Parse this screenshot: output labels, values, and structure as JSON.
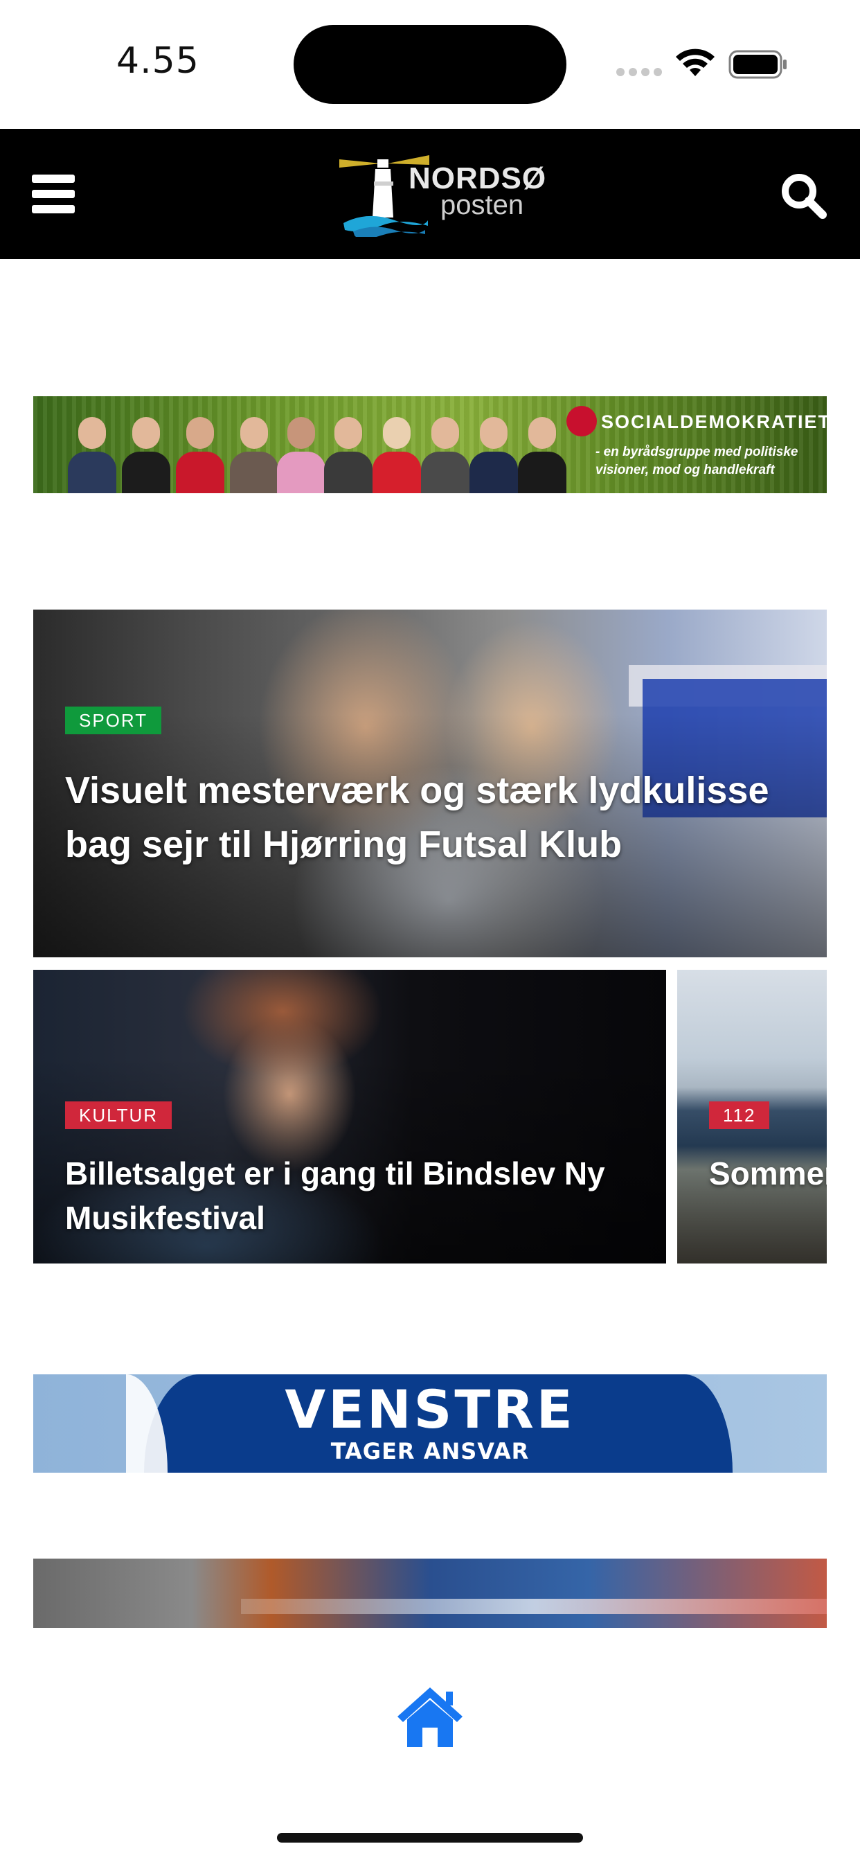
{
  "status_bar": {
    "time": "4.55"
  },
  "header": {
    "logo_word": "NORDSØ",
    "logo_sub": "posten"
  },
  "ads": {
    "socialdemokratiet": {
      "title": "SOCIALDEMOKRATIET",
      "tagline": "- en byrådsgruppe med politiske visioner, mod og handlekraft"
    },
    "venstre": {
      "title": "VENSTRE",
      "subtitle": "TAGER ANSVAR"
    }
  },
  "articles": [
    {
      "category": "SPORT",
      "category_color": "#0f9a3c",
      "headline": "Visuelt mesterværk og stærk lydkulisse bag sejr til Hjørring Futsal Klub"
    },
    {
      "category": "KULTUR",
      "category_color": "#d0273b",
      "headline": "Billetsalget er i gang til Bindslev Ny Musikfestival"
    },
    {
      "category": "112",
      "category_color": "#d0273b",
      "headline": "Sommer kommun"
    }
  ],
  "icons": {
    "menu": "hamburger-icon",
    "search": "search-icon",
    "home": "home-icon",
    "wifi": "wifi-icon",
    "battery": "battery-icon"
  },
  "colors": {
    "header_bg": "#000000",
    "home_icon": "#1877f2"
  }
}
